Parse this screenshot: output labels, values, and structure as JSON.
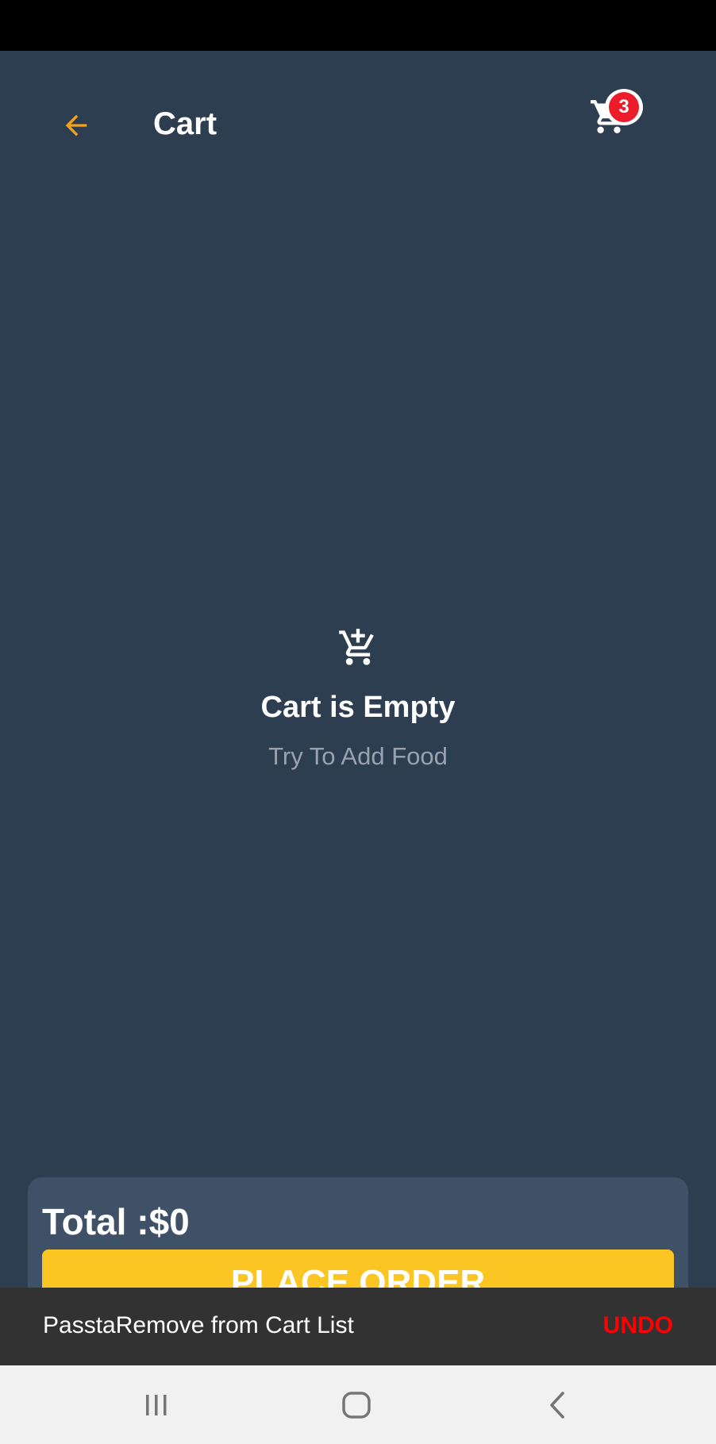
{
  "app_bar": {
    "title": "Cart",
    "back_icon": "arrow-back-icon",
    "cart_icon": "shopping-cart-icon",
    "cart_count": "3",
    "accent_color": "#f4a21c",
    "badge_color": "#ec1c2a"
  },
  "empty_state": {
    "icon": "add-shopping-cart-icon",
    "title": "Cart is Empty",
    "subtitle": "Try To Add Food"
  },
  "summary": {
    "total_label": "Total :$0",
    "place_order_label": "PLACE ORDER",
    "button_color": "#fbc523"
  },
  "snackbar": {
    "message": "PasstaRemove from Cart List",
    "action_label": "UNDO",
    "action_color": "#ff0000"
  },
  "system_nav": {
    "recents_icon": "recents-icon",
    "home_icon": "home-icon",
    "back_icon": "back-chevron-icon"
  }
}
